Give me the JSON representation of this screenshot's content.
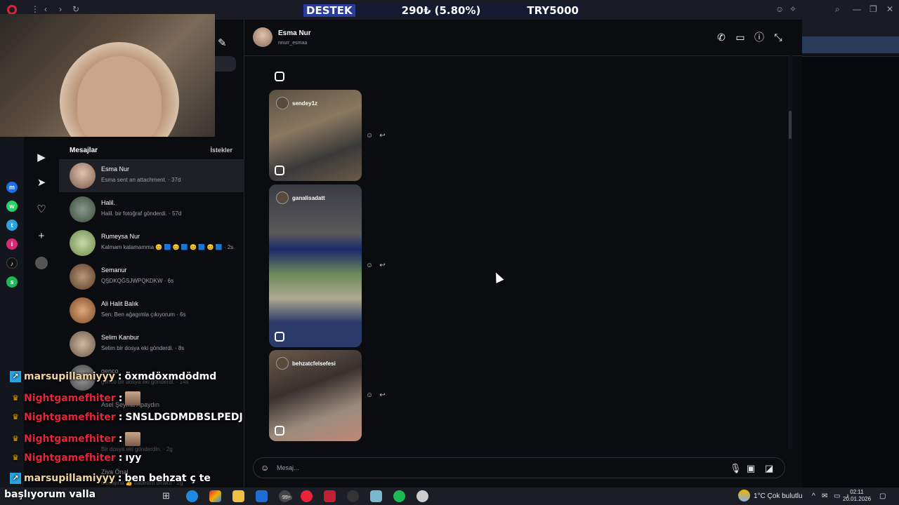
{
  "banner": {
    "left": "DESTEK",
    "middle": "290₺ (5.80%)",
    "right": "TRY5000"
  },
  "messages_panel": {
    "title": "Mesajlar",
    "requests_label": "İstekler",
    "conversations": [
      {
        "name": "Esma Nur",
        "preview": "Esma sent an attachment. · 37d",
        "active": true
      },
      {
        "name": "Halil.",
        "preview": "Halil. bir fotoğraf gönderdi. · 57d"
      },
      {
        "name": "Rumeysa Nur",
        "preview": "Kalmam kalamamma 😊 🟦 😊 🟦 😊 🟦 😊 🟦 · 2s"
      },
      {
        "name": "Semanur",
        "preview": "QŞDKQĞSJWPQKDKW · 6s"
      },
      {
        "name": "Ali Halit Balık",
        "preview": "Sen: Ben ağagımla çıkıyorum · 6s"
      },
      {
        "name": "Selim Kanbur",
        "preview": "Selim bir dosya eki gönderdi. · 8s"
      },
      {
        "name": "genco",
        "preview": "genco bir dosya eki gönderdi. · 14s"
      },
      {
        "name": "Asel Şeyma Apaydın",
        "preview": ""
      },
      {
        "name": "",
        "preview": "Bir dosya eki gönderdin. · 2g"
      },
      {
        "name": "Ziya Önal",
        "preview": "mesajına 👍 ifadesini bıraktı · 2g"
      }
    ]
  },
  "chat": {
    "name": "Esma Nur",
    "username": "nnurr_esmaa",
    "reels": [
      {
        "owner": "sendey1z"
      },
      {
        "owner": "ganalisadatt"
      },
      {
        "owner": "behzatcfelsefesi"
      }
    ],
    "composer_placeholder": "Mesaj..."
  },
  "stream_chat": [
    {
      "user": "marsupillamiyyy",
      "message": "öxmdöxmdödmd",
      "color": "gold"
    },
    {
      "user": "Nightgamefhiter",
      "message": "",
      "color": "red",
      "image": true
    },
    {
      "user": "Nightgamefhiter",
      "message": "SNSLDGDMDBSLPEDJ",
      "color": "red"
    },
    {
      "user": "Nightgamefhiter",
      "message": "",
      "color": "red",
      "image": true
    },
    {
      "user": "Nightgamefhiter",
      "message": "ıyy",
      "color": "red"
    },
    {
      "user": "marsupillamiyyy",
      "message": "ben behzat ç te",
      "color": "gold"
    }
  ],
  "subtitle": "başlıyorum valla",
  "taskbar": {
    "weather": "1°C  Çok bulutlu",
    "time": "02:11",
    "date": "20.01.2026",
    "badge": "99+"
  },
  "colors": {
    "background": "#0b0c10",
    "accent": "#e8243a",
    "gold": "#f0d4a0"
  }
}
